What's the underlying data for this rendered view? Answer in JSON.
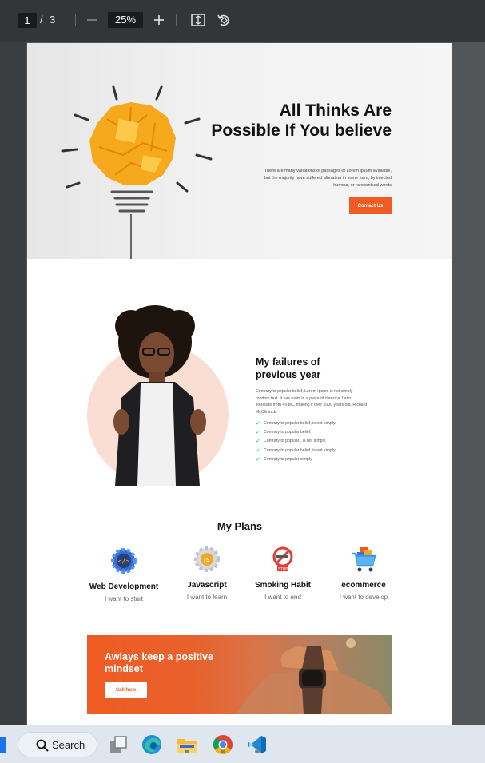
{
  "viewer": {
    "current_page": "1",
    "page_separator": "/",
    "total_pages": "3",
    "zoom": "25%"
  },
  "hero": {
    "title": "All Thinks Are Possible If You believe",
    "text": "There are many variations of passages of Lorem ipsum available, but the majority have suffered alteration in some form, by injected humour, or randomised words",
    "button": "Contact Us"
  },
  "failures": {
    "title": "My failures of previous year",
    "text": "Contrary to popular belief, Lorem Ipsum is not simply random text. It has roots in a piece of classical Latin literature from 45 BC, making it over 2000 years old. Richard McClintock.",
    "items": [
      "Contrary to popular belief, is not simply.",
      "Contrary to popular belief.",
      "Contrary to popular , is not simply.",
      "Contrary to popular belief, is not simply.",
      "Contrary to popular simply."
    ]
  },
  "plans": {
    "title": "My Plans",
    "items": [
      {
        "name": "Web Development",
        "sub": "I want to start",
        "icon": "web-dev-gear-icon"
      },
      {
        "name": "Javascript",
        "sub": "I want to learn",
        "icon": "javascript-gear-icon"
      },
      {
        "name": "Smoking Habit",
        "sub": "I want to end",
        "icon": "no-smoking-icon"
      },
      {
        "name": "ecommerce",
        "sub": "I want to develop",
        "icon": "shopping-cart-icon"
      }
    ]
  },
  "banner": {
    "title": "Awlays keep a positive mindset",
    "button": "Call Now"
  },
  "taskbar": {
    "search_label": "Search"
  },
  "colors": {
    "accent": "#ef5b23",
    "check": "#2bb673",
    "toolbar": "#323639",
    "circle": "#fbded3"
  }
}
